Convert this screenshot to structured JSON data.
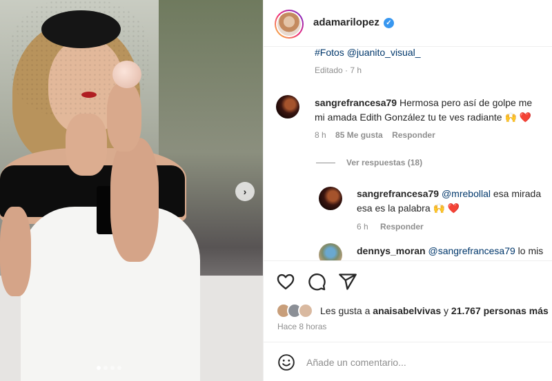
{
  "post": {
    "username": "adamarilopez",
    "caption_tail": "#Fotos @juanito_visual_",
    "edited": "Editado · 7 h"
  },
  "comments": [
    {
      "username": "sangrefrancesa79",
      "line1": "Hermosa pero así de golpe me",
      "line2": "mi amada Edith González tu te ves radiante 🙌 ❤️",
      "time": "8 h",
      "likes": "85 Me gusta",
      "reply": "Responder"
    }
  ],
  "view_replies": "Ver respuestas (18)",
  "replies": [
    {
      "username": "sangrefrancesa79",
      "mention": "@mrebollal",
      "text": "esa mirada",
      "line2": "esa es la palabra 🙌 ❤️",
      "time": "6 h",
      "reply": "Responder"
    },
    {
      "username": "dennys_moran",
      "mention": "@sangrefrancesa79",
      "text": "lo mis"
    }
  ],
  "likes": {
    "prefix": "Les gusta a",
    "user": "anaisabelvivas",
    "middle": "y",
    "count": "21.767 personas más"
  },
  "time_ago": "Hace 8 horas",
  "comment_input": {
    "placeholder": "Añade un comentario..."
  },
  "icons": [
    "heart-icon",
    "comment-icon",
    "share-icon",
    "emoji-icon",
    "verified-icon",
    "chevron-right-icon"
  ],
  "colors": {
    "link": "#00376b",
    "muted": "#8e8e8e",
    "verified": "#3897f0"
  }
}
